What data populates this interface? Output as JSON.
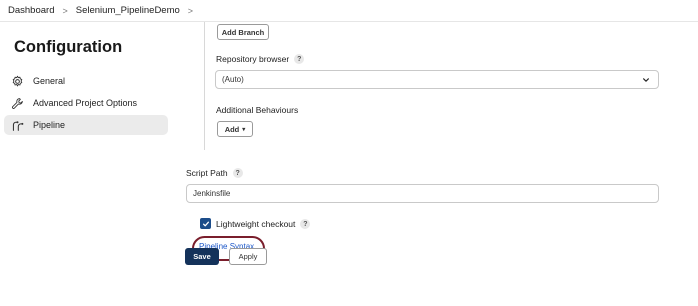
{
  "breadcrumb": {
    "items": [
      "Dashboard",
      "Selenium_PipelineDemo"
    ],
    "separator": ">"
  },
  "sidebar": {
    "title": "Configuration",
    "items": [
      {
        "label": "General",
        "icon": "gear-icon"
      },
      {
        "label": "Advanced Project Options",
        "icon": "wrench-icon"
      },
      {
        "label": "Pipeline",
        "icon": "pipeline-icon",
        "active": true
      }
    ]
  },
  "scm": {
    "add_branch_label": "Add Branch",
    "repository_browser": {
      "label": "Repository browser",
      "help": "?",
      "value": "(Auto)"
    },
    "additional_behaviours": {
      "label": "Additional Behaviours",
      "add_label": "Add"
    }
  },
  "script_path": {
    "label": "Script Path",
    "help": "?",
    "value": "Jenkinsfile"
  },
  "lightweight_checkout": {
    "label": "Lightweight checkout",
    "help": "?",
    "checked": true
  },
  "pipeline_syntax_link": "Pipeline Syntax",
  "footer": {
    "save_label": "Save",
    "apply_label": "Apply"
  },
  "colors": {
    "primary": "#14325a",
    "link": "#1a56c8",
    "highlight": "#7a1e2c",
    "active_nav": "#ebebeb"
  }
}
